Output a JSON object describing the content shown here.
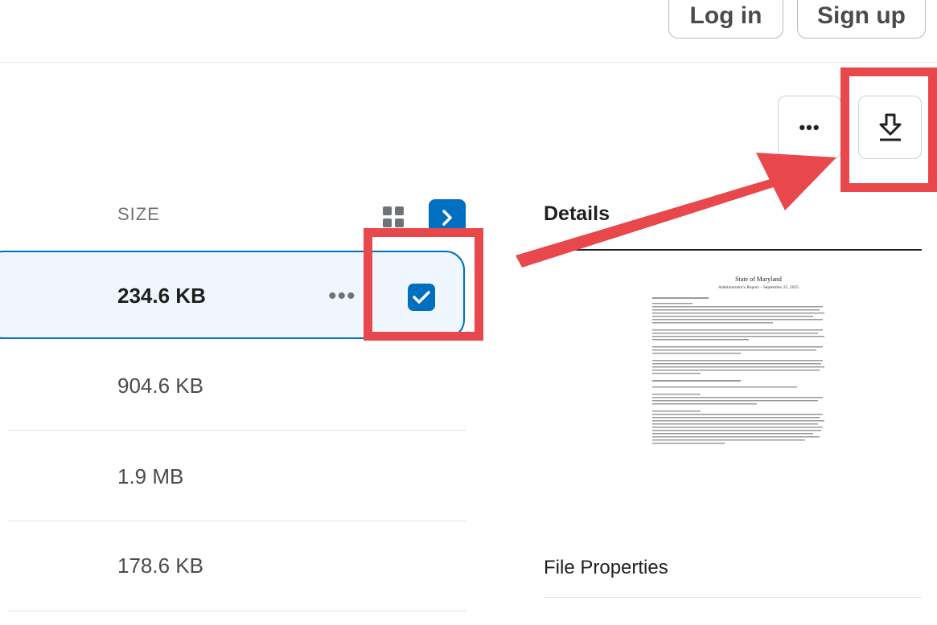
{
  "header": {
    "login_label": "Log in",
    "signup_label": "Sign up"
  },
  "toolbar": {
    "more_label": "•••",
    "download_icon": "download-icon"
  },
  "list": {
    "column_header": "SIZE",
    "rows": [
      {
        "size": "234.6 KB",
        "selected": true
      },
      {
        "size": "904.6 KB",
        "selected": false
      },
      {
        "size": "1.9 MB",
        "selected": false
      },
      {
        "size": "178.6 KB",
        "selected": false
      }
    ],
    "row_more_label": "•••"
  },
  "details": {
    "title": "Details",
    "preview": {
      "doc_title": "State of Maryland",
      "doc_subtitle": "Administrator's Report – September 25, 2025"
    },
    "file_properties_label": "File Properties"
  },
  "colors": {
    "accent": "#006fbf",
    "selected_bg": "#f0f6fd",
    "annotation_red": "#e8474b"
  }
}
